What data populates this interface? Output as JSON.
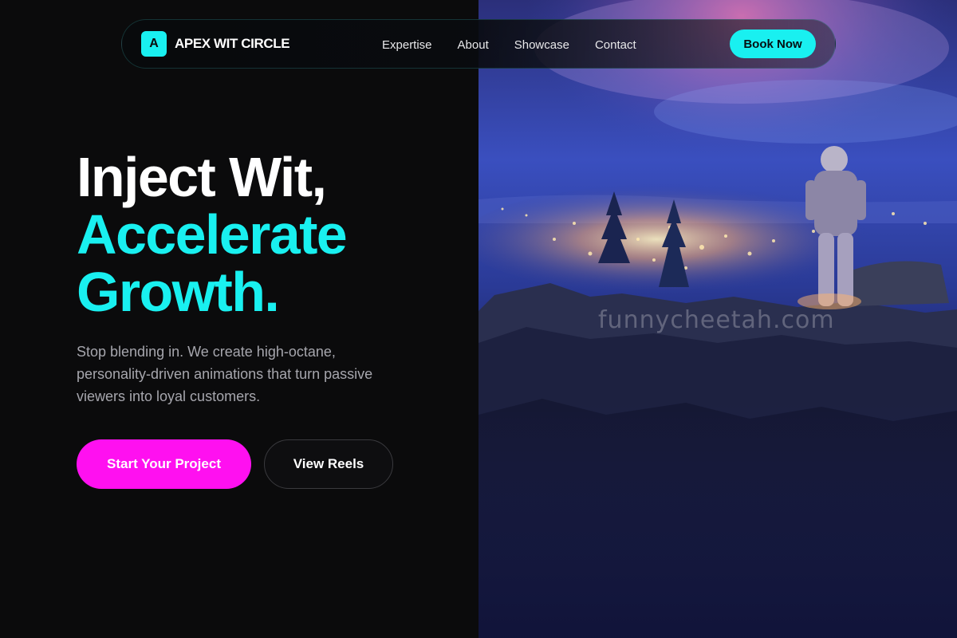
{
  "nav": {
    "brand_mark": "A",
    "brand_name": "APEX WIT CIRCLE",
    "links": [
      "Expertise",
      "About",
      "Showcase",
      "Contact"
    ],
    "cta": "Book Now"
  },
  "hero": {
    "headline_lines": [
      "Inject Wit,",
      "Accelerate",
      "Growth."
    ],
    "subtext": "Stop blending in. We create high-octane, personality-driven animations that turn passive viewers into loyal customers.",
    "primary_cta": "Start Your Project",
    "secondary_cta": "View Reels"
  },
  "image": {
    "watermark": "funnycheetah.com",
    "subject_icon": "astronaut-on-cliff-night-city"
  },
  "colors": {
    "background": "#0b0b0c",
    "accent_cyan": "#19f0f0",
    "accent_magenta": "#ff10f0",
    "body_text": "#a6a6ad"
  }
}
